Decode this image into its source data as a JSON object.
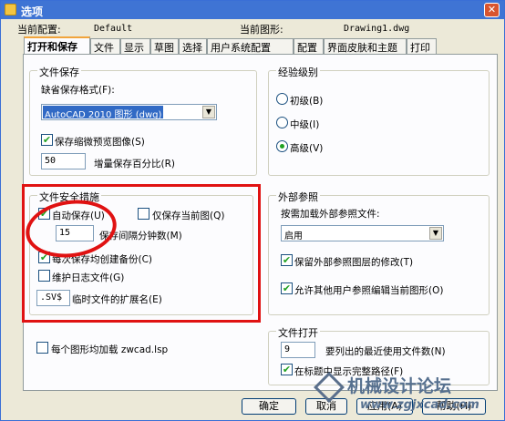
{
  "window": {
    "title": "选项",
    "close_glyph": "✕"
  },
  "header": {
    "current_config_label": "当前配置:",
    "current_config_value": "Default",
    "current_drawing_label": "当前图形:",
    "current_drawing_value": "Drawing1.dwg"
  },
  "tabs": [
    "打开和保存",
    "文件",
    "显示",
    "草图",
    "选择",
    "用户系统配置",
    "配置",
    "界面皮肤和主题",
    "打印"
  ],
  "file_save": {
    "title": "文件保存",
    "default_format_label": "缺省保存格式(F):",
    "default_format_value": "AutoCAD 2010 图形 (dwg)",
    "save_thumbnail_label": "保存缩微预览图像(S)",
    "save_thumbnail_checked": true,
    "incremental_value": "50",
    "incremental_label": "增量保存百分比(R)"
  },
  "experience": {
    "title": "经验级别",
    "options": [
      "初级(B)",
      "中级(I)",
      "高级(V)"
    ],
    "selected": "高级(V)"
  },
  "file_safety": {
    "title": "文件安全措施",
    "autosave_label": "自动保存(U)",
    "autosave_checked": true,
    "save_current_only_label": "仅保存当前图(Q)",
    "save_current_only_checked": false,
    "interval_value": "15",
    "interval_label": "保存间隔分钟数(M)",
    "backup_label": "每次保存均创建备份(C)",
    "backup_checked": true,
    "log_label": "维护日志文件(G)",
    "log_checked": false,
    "temp_ext_value": ".SV$",
    "temp_ext_label": "临时文件的扩展名(E)"
  },
  "xref": {
    "title": "外部参照",
    "demand_load_label": "按需加载外部参照文件:",
    "demand_load_value": "启用",
    "retain_changes_label": "保留外部参照图层的修改(T)",
    "retain_changes_checked": true,
    "allow_edit_label": "允许其他用户参照编辑当前图形(O)",
    "allow_edit_checked": true
  },
  "load_each": {
    "label": "每个图形均加载 zwcad.lsp",
    "checked": false
  },
  "file_open": {
    "title": "文件打开",
    "recent_count_value": "9",
    "recent_count_label": "要列出的最近使用文件数(N)",
    "full_path_label": "在标题中显示完整路径(F)",
    "full_path_checked": true
  },
  "buttons": {
    "ok": "确定",
    "cancel": "取消",
    "apply": "应用(A)",
    "help": "帮助(H)"
  },
  "watermark": {
    "text": "机械设计论坛",
    "url": "www.zgjxcad.com"
  },
  "colors": {
    "titlebar": "#3f74d4",
    "annotation_red": "#e01212",
    "check_green": "#21a121"
  }
}
